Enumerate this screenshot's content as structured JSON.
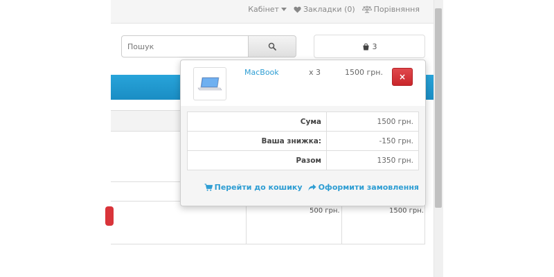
{
  "topbar": {
    "account": "Кабінет",
    "wishlist": "Закладки (0)",
    "compare": "Порівняння"
  },
  "search": {
    "placeholder": "Пошук"
  },
  "cart_button": {
    "count": "3"
  },
  "cart": {
    "items": [
      {
        "name": "MacBook",
        "qty": "x 3",
        "price": "1500 грн.",
        "remove": "×"
      }
    ],
    "totals": [
      {
        "label": "Сума",
        "value": "1500 грн."
      },
      {
        "label": "Ваша знижка:",
        "value": "-150 грн."
      },
      {
        "label": "Разом",
        "value": "1350 грн."
      }
    ],
    "view_cart": "Перейти до кошику",
    "checkout": "Оформити замовлення"
  },
  "background_table": {
    "unit_price": "500 грн.",
    "total": "1500 грн."
  },
  "colors": {
    "accent": "#2d9dd3",
    "danger": "#d9343a",
    "menu": "#1f96cf"
  }
}
